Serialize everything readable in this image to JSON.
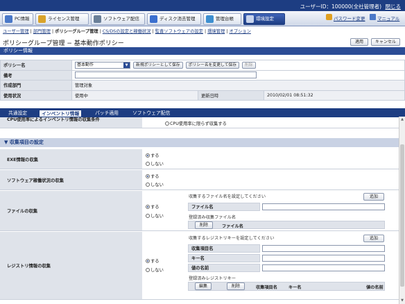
{
  "top": {
    "user": "ユーザーID：100000(全社管理者)",
    "logout": "閉じる"
  },
  "menu": {
    "tabs": [
      {
        "label": "PC情報",
        "icon": "pc-icon",
        "color": "#4a78c8"
      },
      {
        "label": "ライセンス管理",
        "icon": "license-icon",
        "color": "#d9a32a"
      },
      {
        "label": "ソフトウェア配信",
        "icon": "delivery-icon",
        "color": "#6a7f98"
      },
      {
        "label": "ディスク消去管理",
        "icon": "disk-icon",
        "color": "#3b6fcf"
      },
      {
        "label": "管理台帳",
        "icon": "ledger-icon",
        "color": "#3d8fd0"
      },
      {
        "label": "環境設定",
        "icon": "settings-icon",
        "color": "#c8d4ec"
      }
    ],
    "password_link": "パスワード変更",
    "manual_link": "マニュアル"
  },
  "breadcrumb": [
    {
      "label": "ユーザー管理",
      "current": false
    },
    {
      "label": "部門管理",
      "current": false
    },
    {
      "label": "ポリシーグループ管理",
      "current": true
    },
    {
      "label": "CS/DSの設定と稼働状況",
      "current": false
    },
    {
      "label": "監査ソフトウェアの設定",
      "current": false
    },
    {
      "label": "環境管理",
      "current": false
    },
    {
      "label": "オプション",
      "current": false
    }
  ],
  "page": {
    "title": "ポリシーグループ管理 − 基本動作ポリシー",
    "apply": "適用",
    "cancel": "キャンセル"
  },
  "policy": {
    "section_title": "ポリシー情報",
    "name_label": "ポリシー名",
    "name_value": "基本動作",
    "btn_save_new": "新規ポリシーとして保存",
    "btn_rename_save": "ポリシー名を変更して保存",
    "btn_delete": "削除",
    "note_label": "備考",
    "dept_label": "作成部門",
    "dept_value": "管理対象",
    "status_label": "使用状況",
    "status_value": "使用中",
    "updated_label": "更新日時",
    "updated_value": "2010/02/01 08:51:32"
  },
  "tabs": [
    {
      "label": "共通設定",
      "active": false
    },
    {
      "label": "インベントリ情報",
      "active": true
    },
    {
      "label": "パッチ適用",
      "active": false
    },
    {
      "label": "ソフトウェア配信",
      "active": false
    }
  ],
  "inventory": {
    "cpu_label_partial": "CPU使用率によるインベントリ情報の収集条件",
    "cpu_option": "CPU使用率に限らず収集する",
    "collect_section": "▼ 収集項目の設定",
    "exe": {
      "label": "EXE情報の収集",
      "yes": "する",
      "no": "しない"
    },
    "sw": {
      "label": "ソフトウェア稼働状況の収集",
      "yes": "する",
      "no": "しない"
    },
    "file": {
      "label": "ファイルの収集",
      "yes": "する",
      "no": "しない",
      "hint": "収集するファイル名を設定してください",
      "add": "追加",
      "name_label": "ファイル名",
      "registered": "登録済み収集ファイル名",
      "delete": "削除",
      "col_name": "ファイル名"
    },
    "registry": {
      "label": "レジストリ情報の収集",
      "yes": "する",
      "no": "しない",
      "hint": "収集するレジストリキーを設定してください",
      "add": "追加",
      "item_label": "収集項目名",
      "key_label": "キー名",
      "value_label": "値の名前",
      "registered": "登録済みレジストリキー",
      "edit": "編集",
      "delete": "削除",
      "col_item": "収集項目名",
      "col_key": "キー名",
      "col_value": "値の名前"
    }
  }
}
